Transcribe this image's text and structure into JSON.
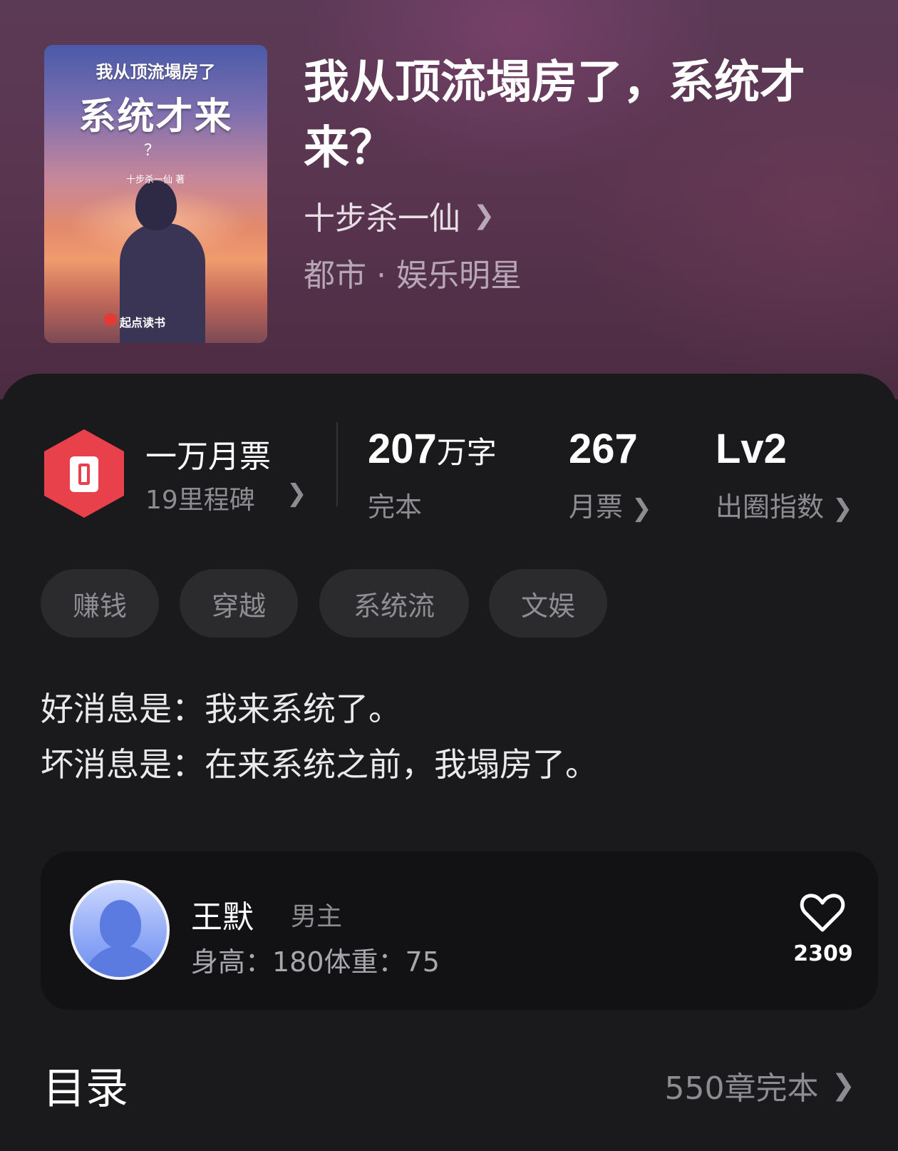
{
  "book": {
    "title": "我从顶流塌房了，系统才来？",
    "author": "十步杀一仙",
    "genre": "都市 · 娱乐明星",
    "cover": {
      "top_text": "我从顶流塌房了",
      "big_text": "系统才来",
      "question": "？",
      "author_text": "十步杀一仙 著",
      "brand": "起点读书"
    }
  },
  "stats": {
    "monthly_vote": {
      "title": "一万月票",
      "sub": "19里程碑"
    },
    "words": {
      "value": "207",
      "unit": "万字",
      "label": "完本"
    },
    "votes": {
      "value": "267",
      "label": "月票"
    },
    "index": {
      "value": "Lv2",
      "label": "出圈指数"
    }
  },
  "tags": [
    "赚钱",
    "穿越",
    "系统流",
    "文娱"
  ],
  "description": [
    "好消息是：我来系统了。",
    "坏消息是：在来系统之前，我塌房了。"
  ],
  "character": {
    "name": "王默",
    "role": "男主",
    "info": "身高：180体重：75",
    "likes": "2309"
  },
  "toc": {
    "title": "目录",
    "meta": "550章完本"
  },
  "icons": {
    "chevron": "chevron-right-icon",
    "heart": "heart-icon",
    "ticket": "ticket-icon"
  },
  "colors": {
    "accent": "#e8414b",
    "panel": "#1a1a1c"
  }
}
